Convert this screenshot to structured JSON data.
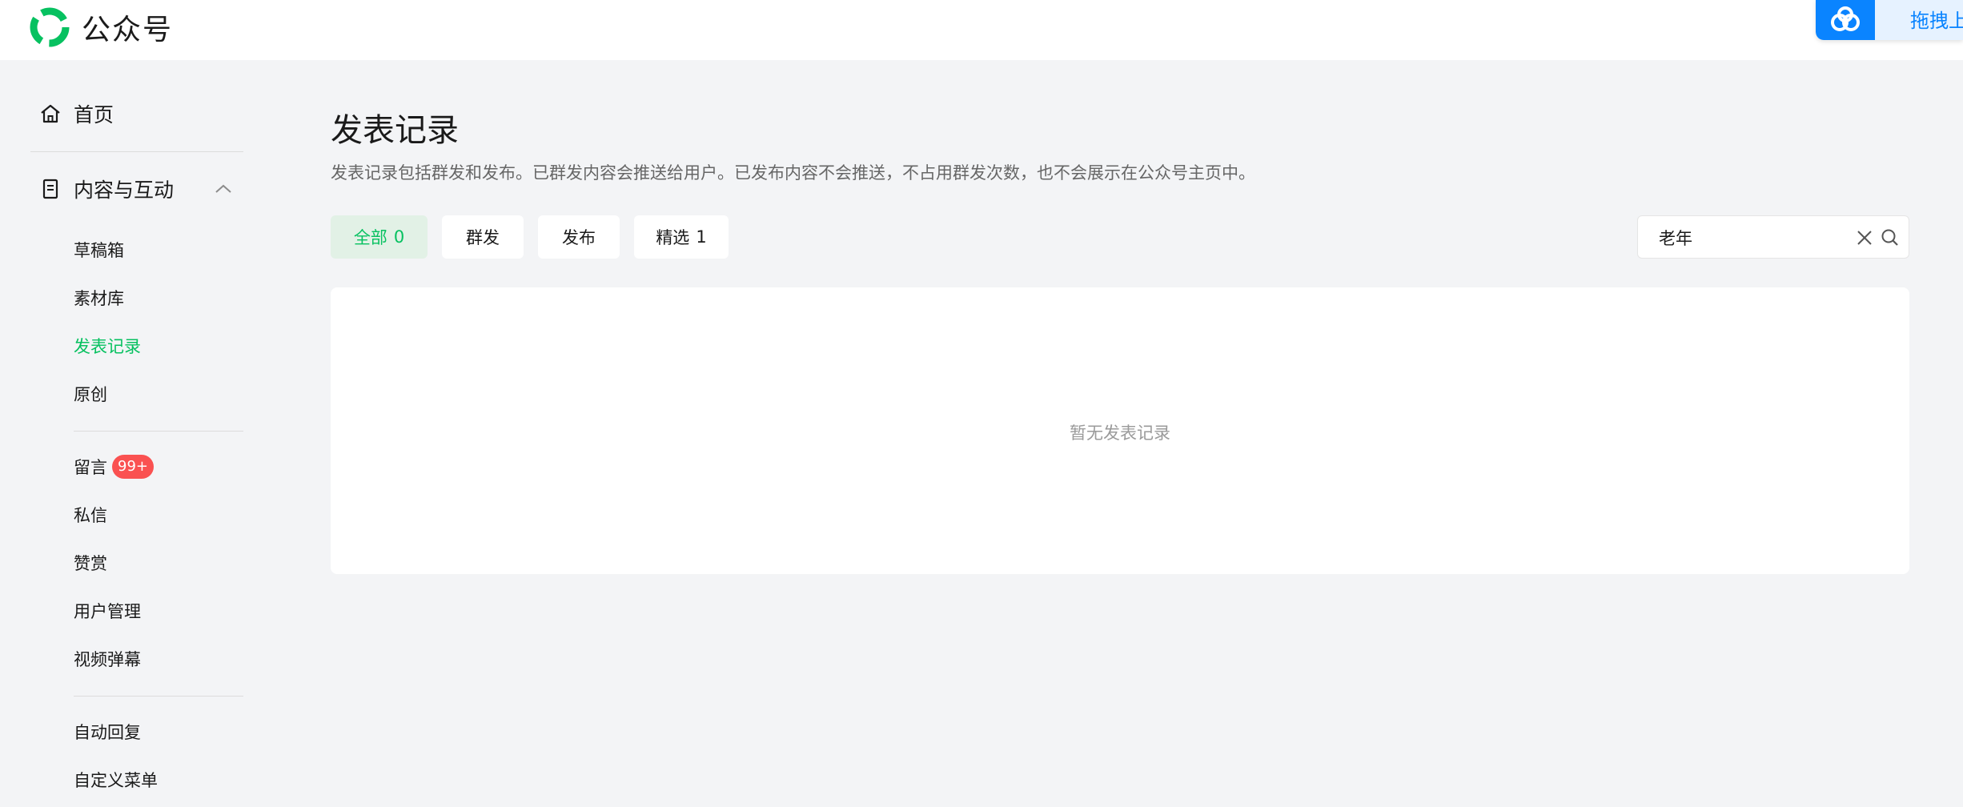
{
  "header": {
    "brand_name": "公众号",
    "brand_icon": "wechat-official-account-logo",
    "widget_label": "拖拽上",
    "widget_icon": "baidu-netdisk-icon"
  },
  "sidebar": {
    "home_label": "首页",
    "home_icon": "home-icon",
    "content_group_label": "内容与互动",
    "content_group_icon": "document-icon",
    "items": [
      {
        "label": "草稿箱"
      },
      {
        "label": "素材库"
      },
      {
        "label": "发表记录",
        "active": true
      },
      {
        "label": "原创"
      },
      {
        "label": "留言",
        "badge": "99+"
      },
      {
        "label": "私信"
      },
      {
        "label": "赞赏"
      },
      {
        "label": "用户管理"
      },
      {
        "label": "视频弹幕"
      },
      {
        "label": "自动回复"
      },
      {
        "label": "自定义菜单"
      }
    ]
  },
  "main": {
    "title": "发表记录",
    "description": "发表记录包括群发和发布。已群发内容会推送给用户。已发布内容不会推送，不占用群发次数，也不会展示在公众号主页中。",
    "tabs": [
      {
        "label": "全部",
        "count": "0",
        "active": true
      },
      {
        "label": "群发"
      },
      {
        "label": "发布"
      },
      {
        "label": "精选",
        "count": "1"
      }
    ],
    "search": {
      "value": "老年",
      "placeholder": ""
    },
    "empty_text": "暂无发表记录"
  },
  "colors": {
    "accent": "#07c160",
    "badge": "#fa5151",
    "background": "#f3f4f6",
    "widget": "#0a84ff"
  }
}
